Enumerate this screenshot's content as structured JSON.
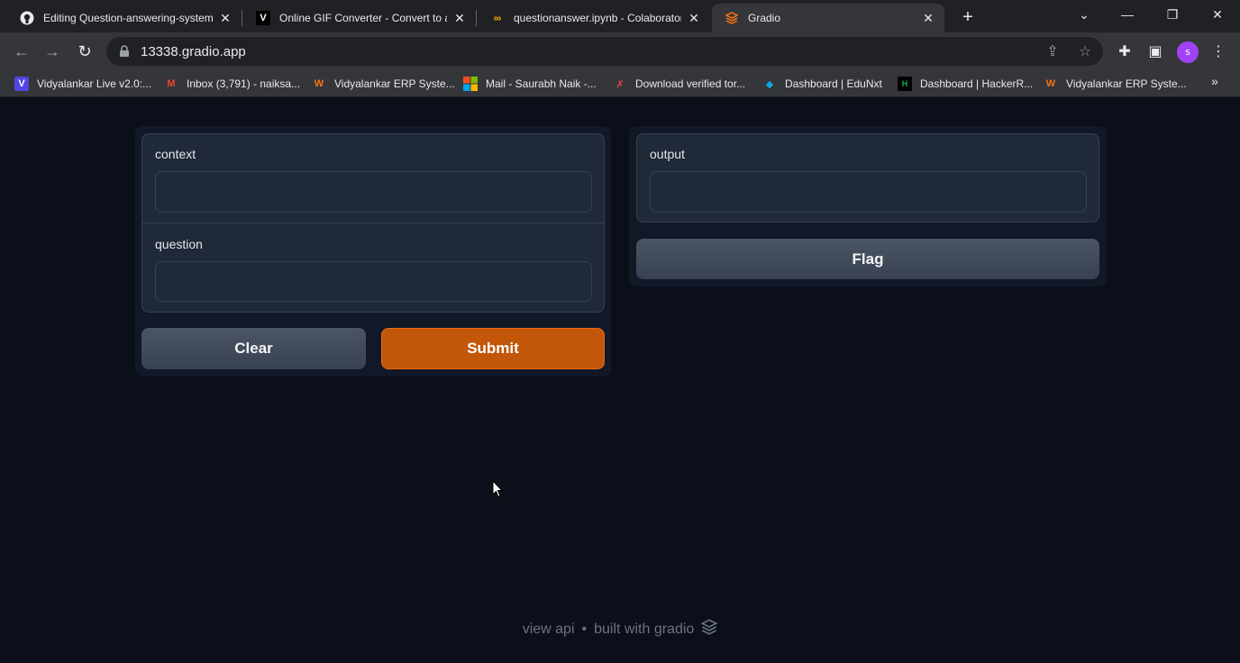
{
  "browser": {
    "tabs": [
      {
        "title": "Editing Question-answering-system",
        "favicon": "github-icon"
      },
      {
        "title": "Online GIF Converter - Convert to a",
        "favicon": "v-logo-icon"
      },
      {
        "title": "questionanswer.ipynb - Colaboratory",
        "favicon": "colab-icon"
      },
      {
        "title": "Gradio",
        "favicon": "gradio-icon",
        "active": true
      }
    ],
    "url": "13338.gradio.app",
    "profile_initial": "s",
    "bookmarks": [
      {
        "label": "Vidyalankar Live v2.0:...",
        "icon": "v-icon"
      },
      {
        "label": "Inbox (3,791) - naiksa...",
        "icon": "gmail-icon"
      },
      {
        "label": "Vidyalankar ERP Syste...",
        "icon": "vidyalankar-icon"
      },
      {
        "label": "Mail - Saurabh Naik -...",
        "icon": "microsoft-icon"
      },
      {
        "label": "Download verified tor...",
        "icon": "x-icon"
      },
      {
        "label": "Dashboard | EduNxt",
        "icon": "edunxt-icon"
      },
      {
        "label": "Dashboard | HackerR...",
        "icon": "hackerrank-icon"
      },
      {
        "label": "Vidyalankar ERP Syste...",
        "icon": "vidyalankar-icon"
      }
    ]
  },
  "app": {
    "inputs": {
      "context_label": "context",
      "context_value": "",
      "question_label": "question",
      "question_value": ""
    },
    "buttons": {
      "clear": "Clear",
      "submit": "Submit",
      "flag": "Flag"
    },
    "output": {
      "label": "output",
      "value": ""
    },
    "footer": {
      "view_api": "view api",
      "separator": "•",
      "built_with": "built with gradio"
    }
  },
  "colors": {
    "accent": "#c2570a",
    "background": "#0b0f19",
    "panel": "#1f2937"
  }
}
